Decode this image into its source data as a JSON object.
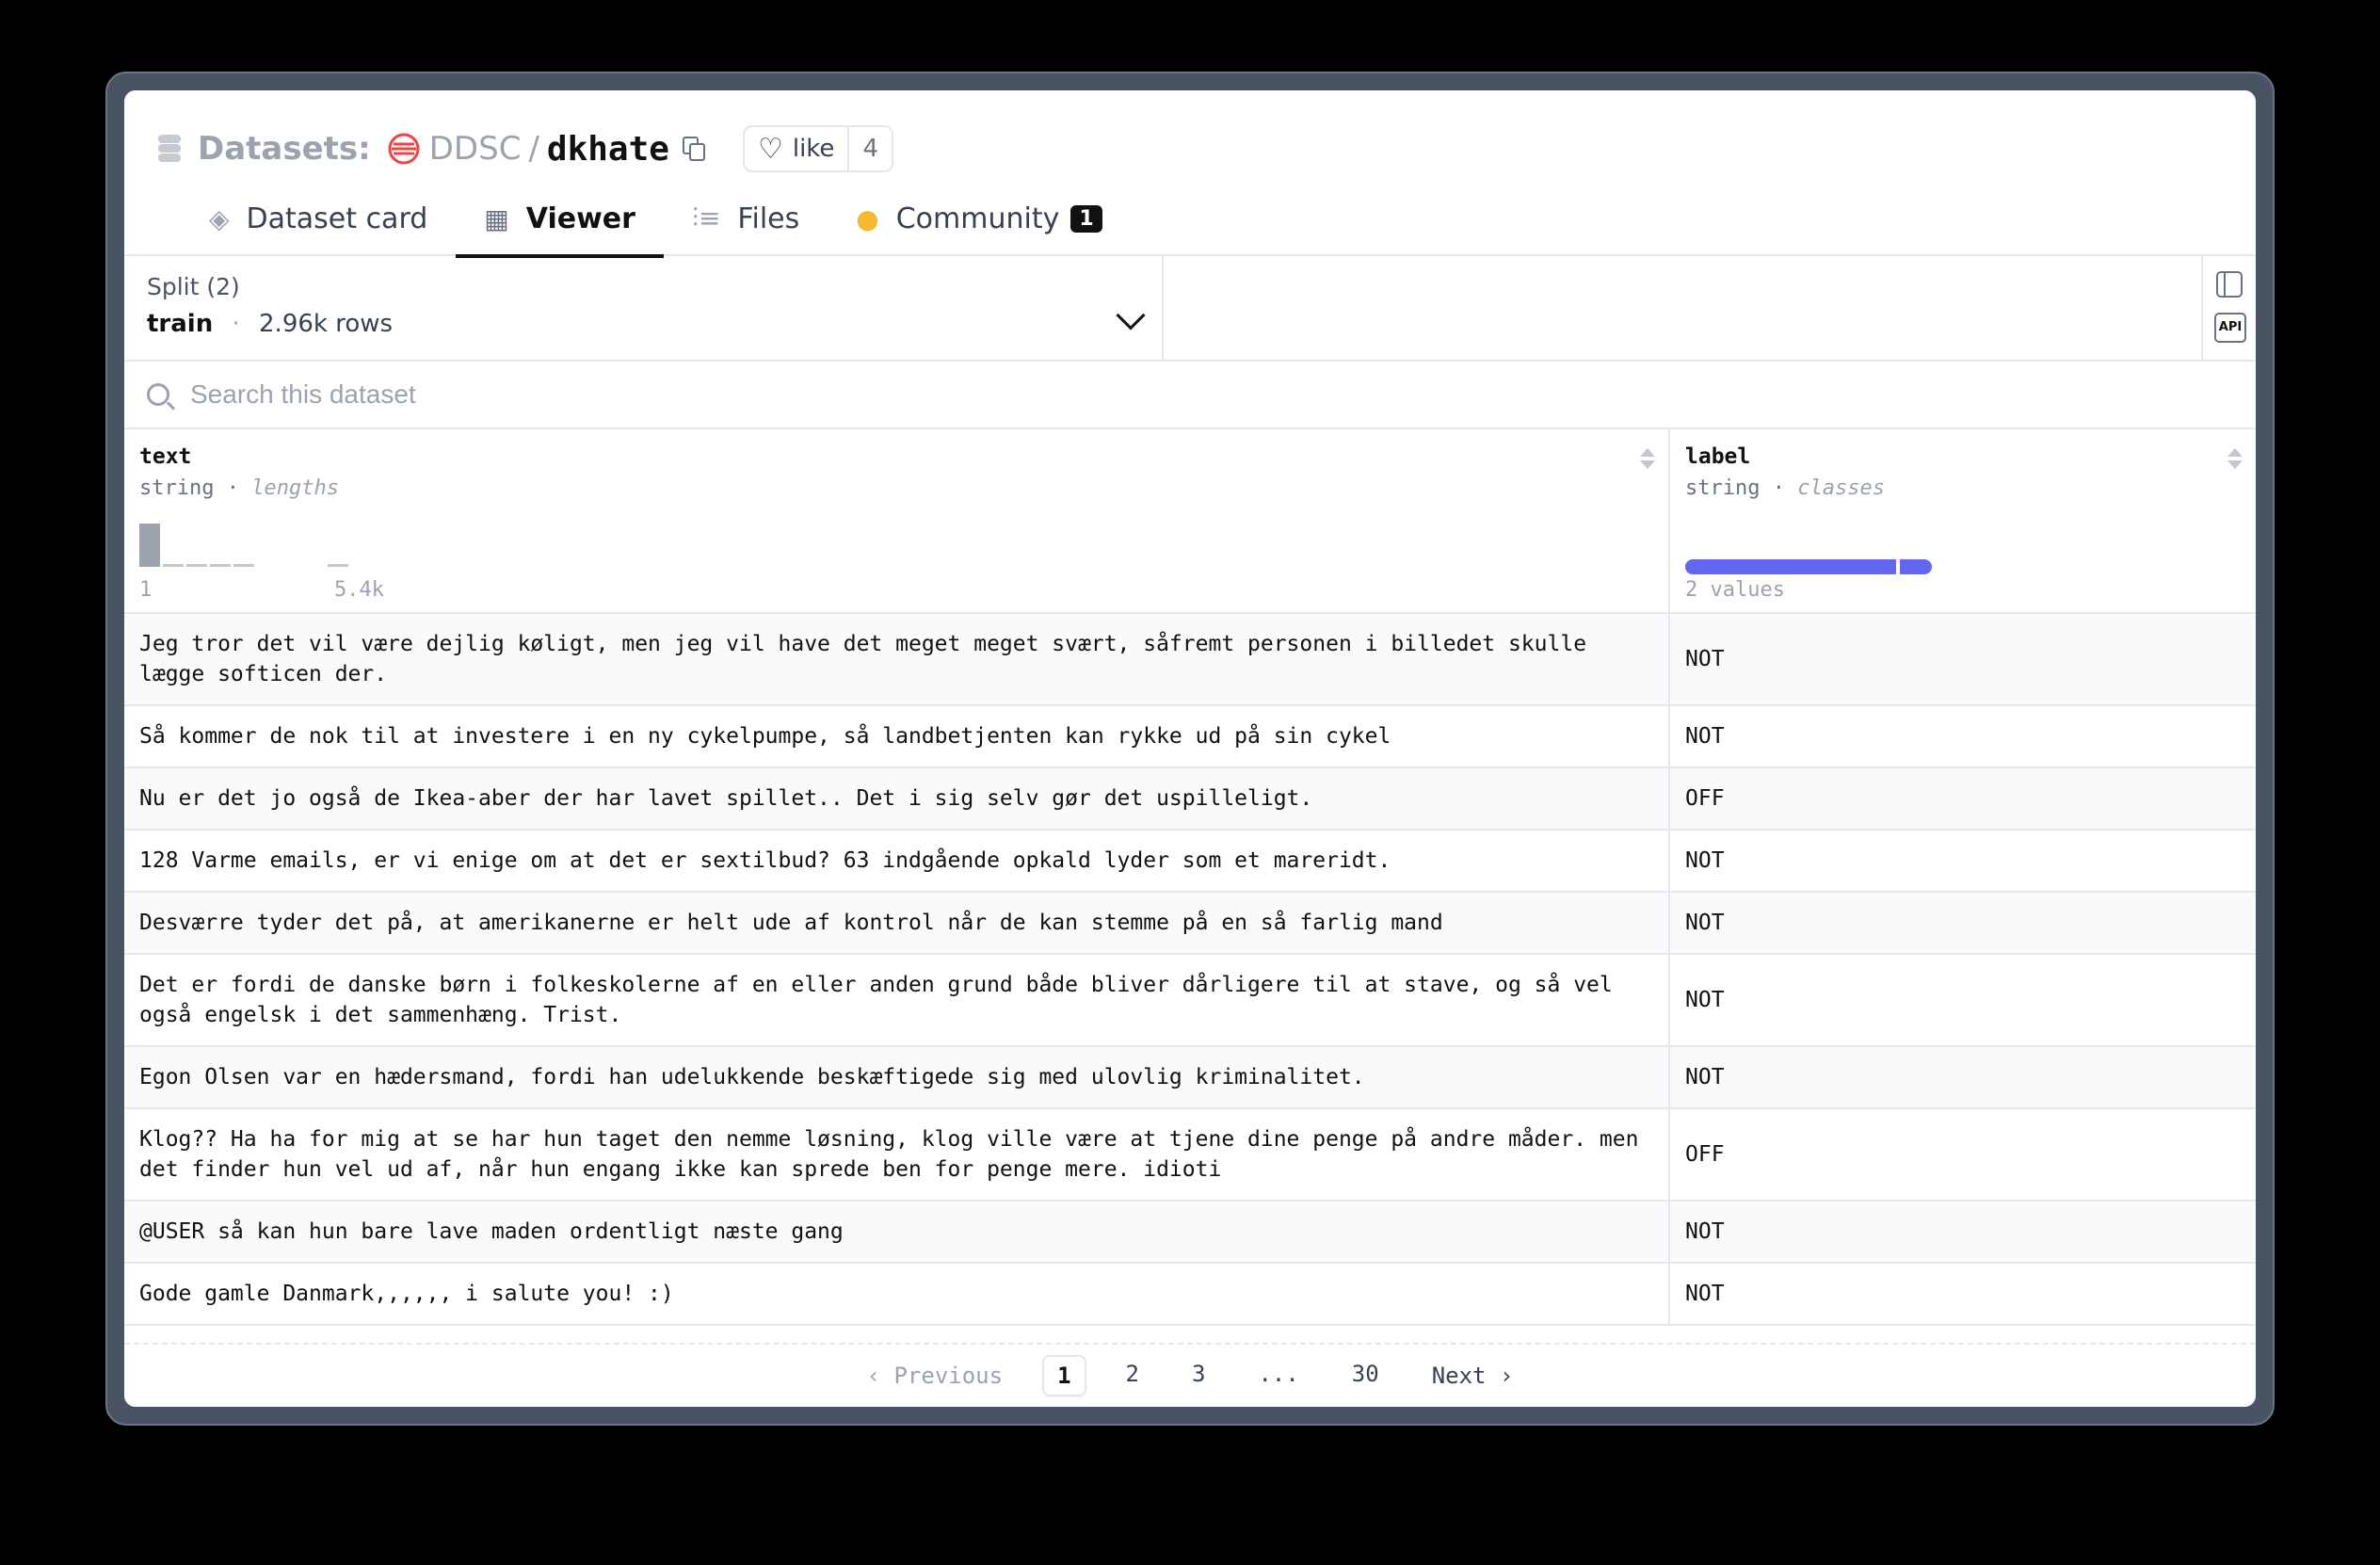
{
  "header": {
    "datasets_label": "Datasets:",
    "org": "DDSC",
    "separator": "/",
    "repo": "dkhate",
    "like_label": "like",
    "like_count": "4"
  },
  "tabs": [
    {
      "label": "Dataset card",
      "icon": "cube-icon"
    },
    {
      "label": "Viewer",
      "icon": "table-icon",
      "active": true
    },
    {
      "label": "Files",
      "icon": "files-icon"
    },
    {
      "label": "Community",
      "icon": "community-icon",
      "badge": "1"
    }
  ],
  "split": {
    "label": "Split (2)",
    "name": "train",
    "separator": "·",
    "rows": "2.96k rows"
  },
  "search": {
    "placeholder": "Search this dataset"
  },
  "columns": {
    "text": {
      "name": "text",
      "type": "string",
      "separator": "·",
      "stat": "lengths",
      "range_min": "1",
      "range_max": "5.4k",
      "histogram": [
        1.0,
        0.06,
        0.06,
        0.06,
        0.06,
        0.0,
        0.0,
        0.0,
        0.06
      ]
    },
    "label": {
      "name": "label",
      "type": "string",
      "separator": "·",
      "stat": "classes",
      "values_text": "2 values",
      "class_fractions": [
        0.87,
        0.13
      ],
      "bar_color": "#6366f1"
    }
  },
  "rows": [
    {
      "text": "Jeg tror det vil være dejlig køligt, men jeg vil have det meget meget svært, såfremt personen i billedet skulle lægge softicen der.",
      "label": "NOT"
    },
    {
      "text": "Så kommer de nok til at investere i en ny cykelpumpe, så landbetjenten kan rykke ud på sin cykel",
      "label": "NOT"
    },
    {
      "text": "Nu er det jo også de Ikea-aber der har lavet spillet.. Det i sig selv gør det uspilleligt.",
      "label": "OFF"
    },
    {
      "text": "128 Varme emails, er vi enige om at det er sextilbud? 63 indgående opkald lyder som et mareridt.",
      "label": "NOT"
    },
    {
      "text": "Desværre tyder det på, at amerikanerne er helt ude af kontrol når de kan stemme på en så farlig mand",
      "label": "NOT"
    },
    {
      "text": "Det er fordi de danske børn i folkeskolerne af en eller anden grund både bliver dårligere til at stave, og så vel også engelsk i det sammenhæng. Trist.",
      "label": "NOT"
    },
    {
      "text": "Egon Olsen var en hædersmand, fordi han udelukkende beskæftigede sig med ulovlig kriminalitet.",
      "label": "NOT"
    },
    {
      "text": "Klog?? Ha ha for mig at se har hun taget den nemme løsning, klog ville være at tjene dine penge på andre måder. men det finder hun vel ud af, når hun engang ikke kan sprede ben for penge mere. idioti",
      "label": "OFF"
    },
    {
      "text": "@USER så kan hun bare lave maden ordentligt næste gang",
      "label": "NOT"
    },
    {
      "text": "Gode gamle Danmark,,,,,, i salute you! :)",
      "label": "NOT"
    }
  ],
  "pagination": {
    "previous": "Previous",
    "next": "Next",
    "pages": [
      "1",
      "2",
      "3",
      "...",
      "30"
    ],
    "current": "1"
  }
}
